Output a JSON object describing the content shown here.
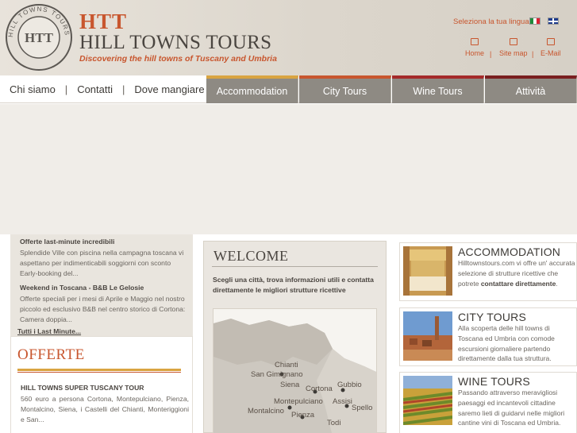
{
  "header": {
    "seal_text": "HILL TOWNS TOURS",
    "seal_abbr": "HTT",
    "brand_abbr": "HTT",
    "brand_name": "HILL TOWNS TOURS",
    "tagline": "Discovering the hill towns of Tuscany and Umbria",
    "language_label": "Seleziona la tua lingua:",
    "languages": [
      "it-flag",
      "en-flag"
    ],
    "util_nav": [
      {
        "label": "Home",
        "icon": "home-icon"
      },
      {
        "label": "Site map",
        "icon": "sitemap-icon"
      },
      {
        "label": "E-Mail",
        "icon": "mail-icon"
      }
    ],
    "util_sep": "|"
  },
  "nav": {
    "left_items": [
      "Chi siamo",
      "Contatti",
      "Dove mangiare"
    ],
    "sep": "|",
    "tabs": [
      "Accommodation",
      "City Tours",
      "Wine Tours",
      "Attività"
    ]
  },
  "left": {
    "news": [
      {
        "title": "Offerte last-minute incredibili",
        "body": "Splendide Ville con piscina nella campagna toscana vi aspettano per indimenticabili soggiorni con sconto Early-booking del..."
      },
      {
        "title": "Weekend in Toscana - B&B Le Gelosie",
        "body": "Offerte speciali per i mesi di Aprile e Maggio nel nostro piccolo ed esclusivo B&B nel centro storico di Cortona: Camera doppia..."
      }
    ],
    "more_link": "Tutti i Last Minute...",
    "offers": {
      "heading": "OFFERTE",
      "title": "HILL TOWNS SUPER TUSCANY TOUR",
      "body": "560 euro a persona Cortona, Montepulciano, Pienza, Montalcino, Siena, i Castelli del Chianti, Monteriggioni e San..."
    }
  },
  "middle": {
    "heading": "WELCOME",
    "text": "Scegli una città, trova informazioni utili e contatta direttamente le migliori strutture ricettive",
    "map_towns": [
      "Chianti",
      "San Gimignano",
      "Siena",
      "Cortona",
      "Gubbio",
      "Montepulciano",
      "Assisi",
      "Spello",
      "Montalcino",
      "Pienza",
      "Todi"
    ]
  },
  "right": {
    "cards": [
      {
        "title": "ACCOMMODATION",
        "body_pre": "Hilltownstours.com vi offre un' accurata selezione di strutture ricettive che potrete ",
        "body_bold": "contattare direttamente",
        "body_post": "."
      },
      {
        "title": "CITY TOURS",
        "body_pre": "Alla scoperta delle hill towns di Toscana ed Umbria con comode escursioni giornaliere partendo direttamente dalla tua struttura.",
        "body_bold": "",
        "body_post": ""
      },
      {
        "title": "WINE TOURS",
        "body_pre": "Passando attraverso meravigliosi paesaggi ed incantevoli cittadine saremo lieti di guidarvi nelle migliori cantine vini di Toscana ed Umbria.",
        "body_bold": "",
        "body_post": ""
      }
    ]
  },
  "colors": {
    "accent": "#c8562e",
    "tab_bg": "#8e8a83",
    "gold": "#d9a441"
  }
}
